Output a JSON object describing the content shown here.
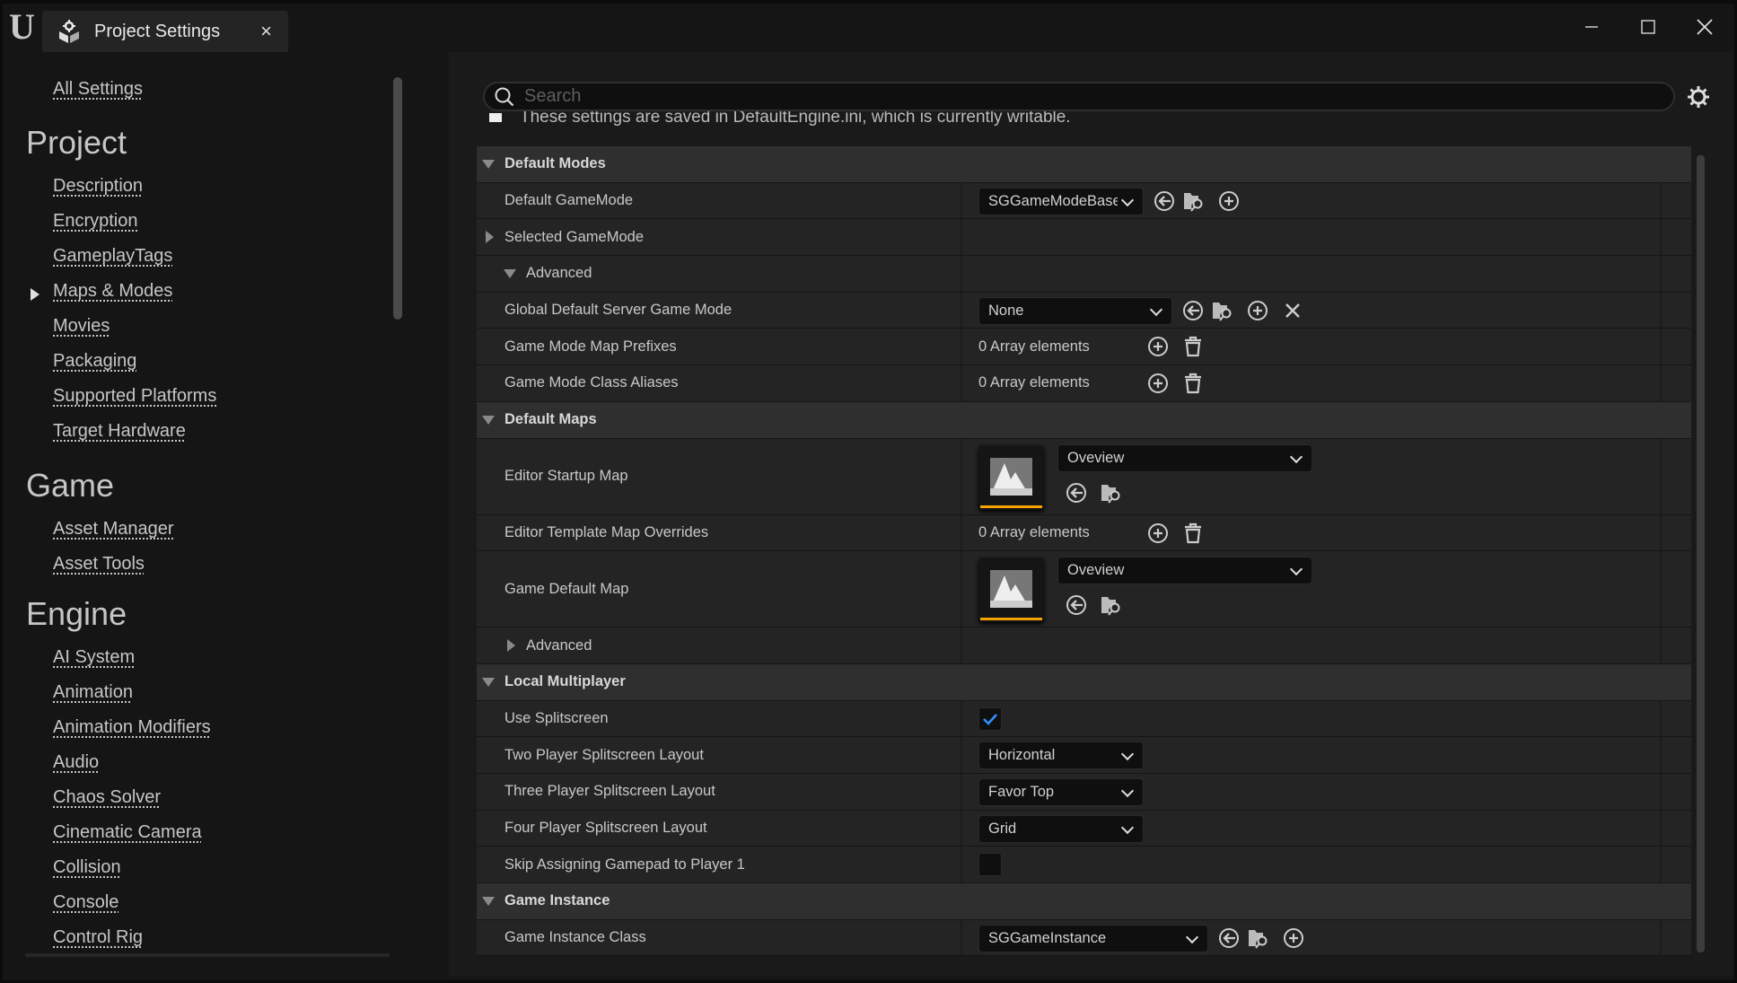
{
  "window": {
    "tab_title": "Project Settings",
    "tab_icon": "project-settings-icon",
    "controls": [
      "minimize-icon",
      "maximize-icon",
      "close-icon"
    ]
  },
  "sidebar": {
    "all_settings": "All Settings",
    "groups": [
      {
        "title": "Project",
        "items": [
          "Description",
          "Encryption",
          "GameplayTags",
          "Maps & Modes",
          "Movies",
          "Packaging",
          "Supported Platforms",
          "Target Hardware"
        ],
        "selected": "Maps & Modes"
      },
      {
        "title": "Game",
        "items": [
          "Asset Manager",
          "Asset Tools"
        ]
      },
      {
        "title": "Engine",
        "items": [
          "AI System",
          "Animation",
          "Animation Modifiers",
          "Audio",
          "Chaos Solver",
          "Cinematic Camera",
          "Collision",
          "Console",
          "Control Rig"
        ]
      }
    ]
  },
  "search": {
    "placeholder": "Search",
    "value": ""
  },
  "info_text": "These settings are saved in DefaultEngine.ini, which is currently writable.",
  "colors": {
    "accent_orange": "#f5a100",
    "check_blue": "#2f8fff",
    "background": "#1a1a1a",
    "row": "#242424",
    "section": "#2f2f2f"
  },
  "rows": [
    {
      "type": "section",
      "label": "Default Modes",
      "expanded": true
    },
    {
      "type": "prop",
      "label": "Default GameMode",
      "value": {
        "kind": "class",
        "combo": "SGGameModeBase",
        "icons": [
          "browse-back",
          "folder-search",
          "add"
        ]
      }
    },
    {
      "type": "group",
      "label": "Selected GameMode",
      "expanded": false,
      "indent": 0
    },
    {
      "type": "group",
      "label": "Advanced",
      "expanded": true,
      "indent": 1
    },
    {
      "type": "prop",
      "label": "Global Default Server Game Mode",
      "value": {
        "kind": "class",
        "combo": "None",
        "icons": [
          "browse-back",
          "folder-search",
          "add",
          "clear"
        ]
      }
    },
    {
      "type": "prop",
      "label": "Game Mode Map Prefixes",
      "value": {
        "kind": "array",
        "text": "0 Array elements"
      }
    },
    {
      "type": "prop",
      "label": "Game Mode Class Aliases",
      "value": {
        "kind": "array",
        "text": "0 Array elements"
      }
    },
    {
      "type": "section",
      "label": "Default Maps",
      "expanded": true
    },
    {
      "type": "prop",
      "label": "Editor Startup Map",
      "value": {
        "kind": "asset",
        "combo": "Oveview"
      }
    },
    {
      "type": "prop",
      "label": "Editor Template Map Overrides",
      "value": {
        "kind": "array",
        "text": "0 Array elements"
      }
    },
    {
      "type": "prop",
      "label": "Game Default Map",
      "value": {
        "kind": "asset",
        "combo": "Oveview"
      }
    },
    {
      "type": "group",
      "label": "Advanced",
      "expanded": false,
      "indent": 1
    },
    {
      "type": "section",
      "label": "Local Multiplayer",
      "expanded": true
    },
    {
      "type": "prop",
      "label": "Use Splitscreen",
      "value": {
        "kind": "checkbox",
        "checked": true
      }
    },
    {
      "type": "prop",
      "label": "Two Player Splitscreen Layout",
      "value": {
        "kind": "enum",
        "combo": "Horizontal"
      }
    },
    {
      "type": "prop",
      "label": "Three Player Splitscreen Layout",
      "value": {
        "kind": "enum",
        "combo": "Favor Top"
      }
    },
    {
      "type": "prop",
      "label": "Four Player Splitscreen Layout",
      "value": {
        "kind": "enum",
        "combo": "Grid"
      }
    },
    {
      "type": "prop",
      "label": "Skip Assigning Gamepad to Player 1",
      "value": {
        "kind": "checkbox",
        "checked": false
      }
    },
    {
      "type": "section",
      "label": "Game Instance",
      "expanded": true
    },
    {
      "type": "prop",
      "label": "Game Instance Class",
      "value": {
        "kind": "class",
        "combo": "SGGameInstance",
        "icons": [
          "browse-back",
          "folder-search",
          "add"
        ]
      }
    }
  ]
}
